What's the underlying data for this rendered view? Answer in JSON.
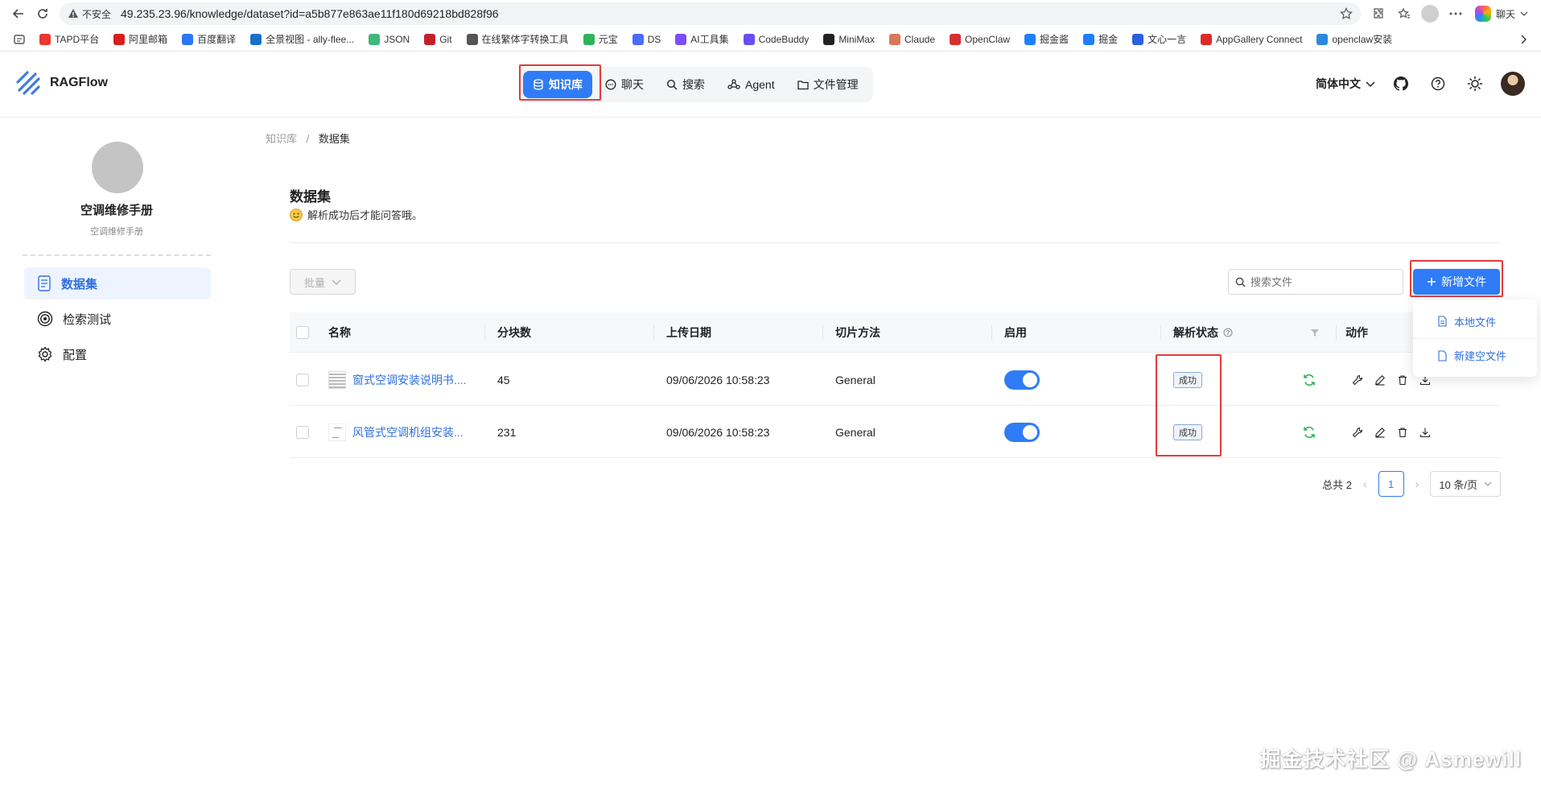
{
  "browser": {
    "security_label": "不安全",
    "url": "49.235.23.96/knowledge/dataset?id=a5b877e863ae11f180d69218bd828f96",
    "chat_label": "聊天"
  },
  "bookmarks": [
    {
      "label": "TAPD平台",
      "color": "#e8382f"
    },
    {
      "label": "阿里邮箱",
      "color": "#d81e1e"
    },
    {
      "label": "百度翻译",
      "color": "#2a76f5"
    },
    {
      "label": "全景视图 - ally-flee...",
      "color": "#1a6fc9"
    },
    {
      "label": "JSON",
      "color": "#3fb67a"
    },
    {
      "label": "Git",
      "color": "#c4202c"
    },
    {
      "label": "在线繁体字转换工具",
      "color": "#555555"
    },
    {
      "label": "元宝",
      "color": "#2fb35a"
    },
    {
      "label": "DS",
      "color": "#4d6bfe"
    },
    {
      "label": "AI工具集",
      "color": "#7b4dff"
    },
    {
      "label": "CodeBuddy",
      "color": "#6a4df5"
    },
    {
      "label": "MiniMax",
      "color": "#222222"
    },
    {
      "label": "Claude",
      "color": "#d97757"
    },
    {
      "label": "OpenClaw",
      "color": "#d63030"
    },
    {
      "label": "掘金酱",
      "color": "#1e80ff"
    },
    {
      "label": "掘金",
      "color": "#1e80ff"
    },
    {
      "label": "文心一言",
      "color": "#2a5fe0"
    },
    {
      "label": "AppGallery Connect",
      "color": "#e02a2a"
    },
    {
      "label": "openclaw安装",
      "color": "#2a8ae0"
    }
  ],
  "app": {
    "logo_text": "RAGFlow",
    "nav": [
      {
        "label": "知识库",
        "icon": "database-icon"
      },
      {
        "label": "聊天",
        "icon": "chat-icon"
      },
      {
        "label": "搜索",
        "icon": "search-icon"
      },
      {
        "label": "Agent",
        "icon": "agent-icon"
      },
      {
        "label": "文件管理",
        "icon": "folder-icon"
      }
    ],
    "language": "简体中文"
  },
  "sidebar": {
    "kb_name": "空调维修手册",
    "kb_desc": "空调维修手册",
    "items": [
      {
        "label": "数据集",
        "icon": "dataset-icon"
      },
      {
        "label": "检索测试",
        "icon": "target-icon"
      },
      {
        "label": "配置",
        "icon": "gear-icon"
      }
    ]
  },
  "main": {
    "breadcrumb_root": "知识库",
    "breadcrumb_sep": "/",
    "breadcrumb_current": "数据集",
    "title": "数据集",
    "subtitle": "解析成功后才能问答哦。",
    "batch_label": "批量",
    "search_placeholder": "搜索文件",
    "add_label": "新增文件",
    "dropdown": [
      "本地文件",
      "新建空文件"
    ],
    "columns": [
      "名称",
      "分块数",
      "上传日期",
      "切片方法",
      "启用",
      "解析状态",
      "动作"
    ],
    "rows": [
      {
        "name": "窗式空调安装说明书....",
        "chunks": "45",
        "date": "09/06/2026 10:58:23",
        "method": "General",
        "enabled": true,
        "status": "成功"
      },
      {
        "name": "风管式空调机组安装...",
        "chunks": "231",
        "date": "09/06/2026 10:58:23",
        "method": "General",
        "enabled": true,
        "status": "成功"
      }
    ],
    "total": "总共 2",
    "page": "1",
    "page_size": "10 条/页"
  },
  "watermark": "掘金技术社区 @ Asmewill",
  "colors": {
    "accent": "#2f7cf6",
    "highlight": "#e23b3b",
    "success": "#2fb35a"
  }
}
